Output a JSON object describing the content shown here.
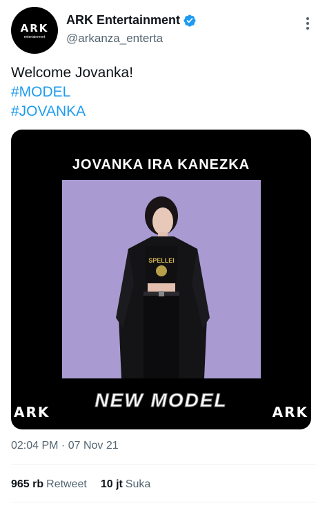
{
  "tweet": {
    "author": {
      "display_name": "ARK Entertainment",
      "handle": "@arkanza_enterta",
      "avatar_logo": "ARK",
      "avatar_sub": "entertainment",
      "verified_icon": "verified-badge-icon"
    },
    "text": {
      "line1": "Welcome Jovanka!",
      "tag1": "#MODEL",
      "tag2": "#JOVANKA"
    },
    "media": {
      "title": "JOVANKA IRA KANEZKA",
      "new_model": "NEW MODEL",
      "corner_logo": "ARK",
      "shirt_text": "SPELLEI"
    },
    "timestamp": "02:04 PM · 07 Nov 21",
    "stats": {
      "retweets_count": "965 rb",
      "retweets_label": "Retweet",
      "likes_count": "10 jt",
      "likes_label": "Suka"
    },
    "colors": {
      "accent": "#1d9bf0",
      "secondary_text": "#536471",
      "photo_bg": "#a99bd1"
    }
  }
}
